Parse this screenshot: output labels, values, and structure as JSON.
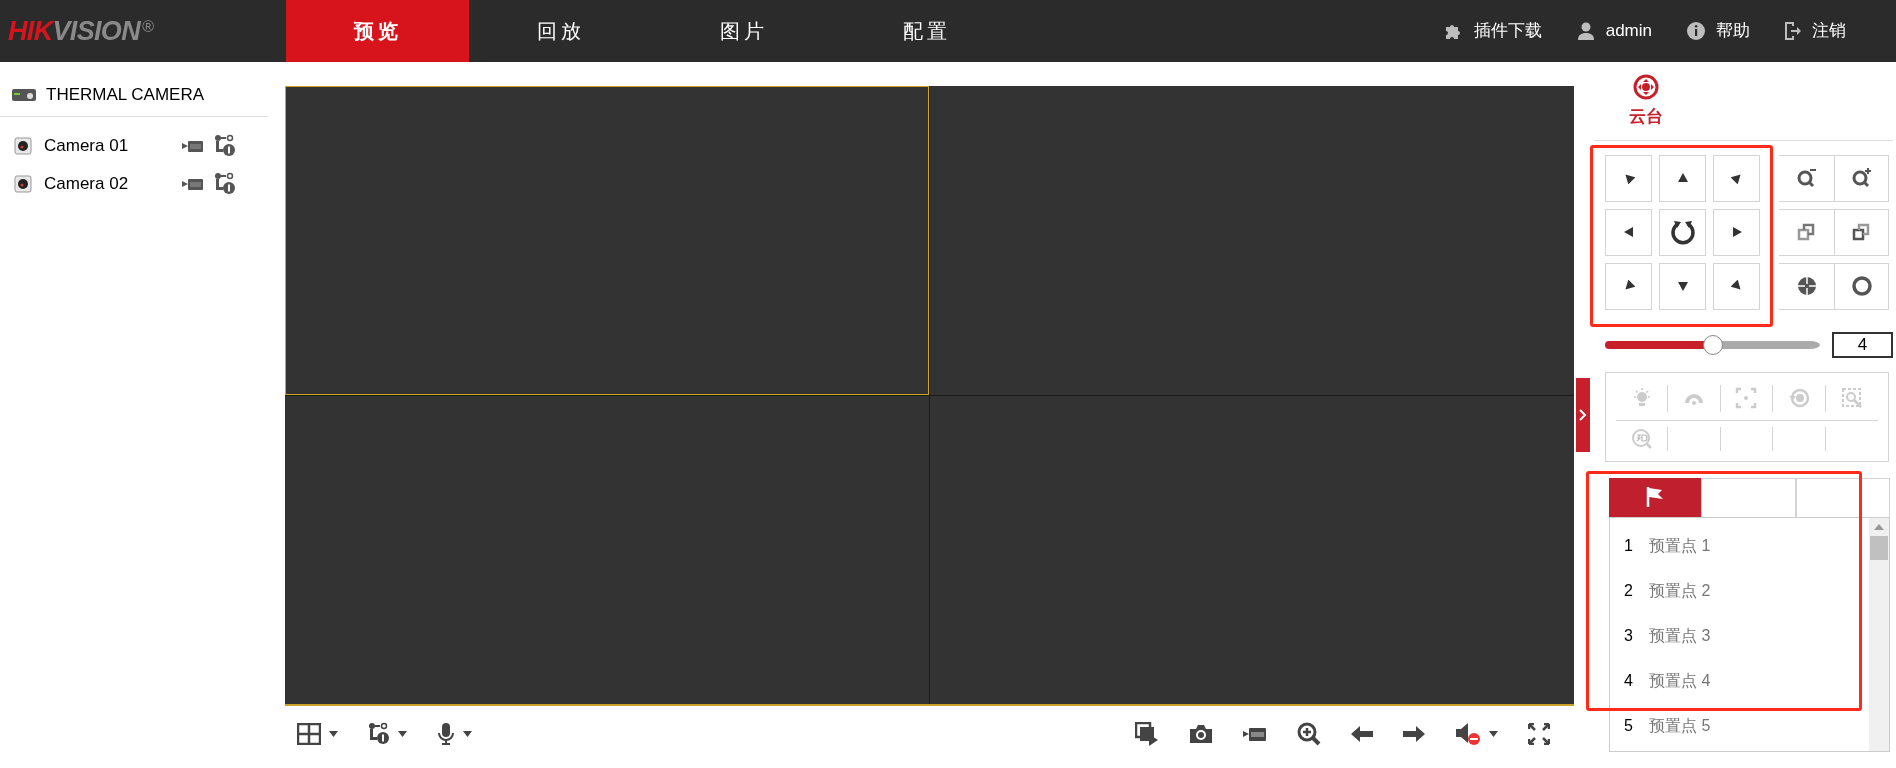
{
  "logo": {
    "prefix": "HIK",
    "suffix": "VISION",
    "mark": "®"
  },
  "nav_tabs": [
    {
      "label": "预览",
      "selected": true
    },
    {
      "label": "回放",
      "selected": false
    },
    {
      "label": "图片",
      "selected": false
    },
    {
      "label": "配置",
      "selected": false
    }
  ],
  "top_actions": [
    {
      "kind": "plugin",
      "label": "插件下载"
    },
    {
      "kind": "user",
      "label": "admin"
    },
    {
      "kind": "help",
      "label": "帮助"
    },
    {
      "kind": "logout",
      "label": "注销"
    }
  ],
  "device": {
    "name": "THERMAL CAMERA",
    "cameras": [
      {
        "name": "Camera 01"
      },
      {
        "name": "Camera 02"
      }
    ]
  },
  "video_windows": [
    {
      "selected": true
    },
    {
      "selected": false
    },
    {
      "selected": false
    },
    {
      "selected": false
    }
  ],
  "ptz": {
    "title": "云台",
    "speed": {
      "level": 0.5,
      "value": "4"
    },
    "preset_tabs": [
      {
        "kind": "preset",
        "selected": true
      },
      {
        "kind": "patrol",
        "selected": false
      },
      {
        "kind": "pattern",
        "selected": false
      }
    ],
    "presets": [
      {
        "number": "1",
        "name": "预置点 1"
      },
      {
        "number": "2",
        "name": "预置点 2"
      },
      {
        "number": "3",
        "name": "预置点 3"
      },
      {
        "number": "4",
        "name": "预置点 4"
      },
      {
        "number": "5",
        "name": "预置点 5"
      }
    ]
  }
}
